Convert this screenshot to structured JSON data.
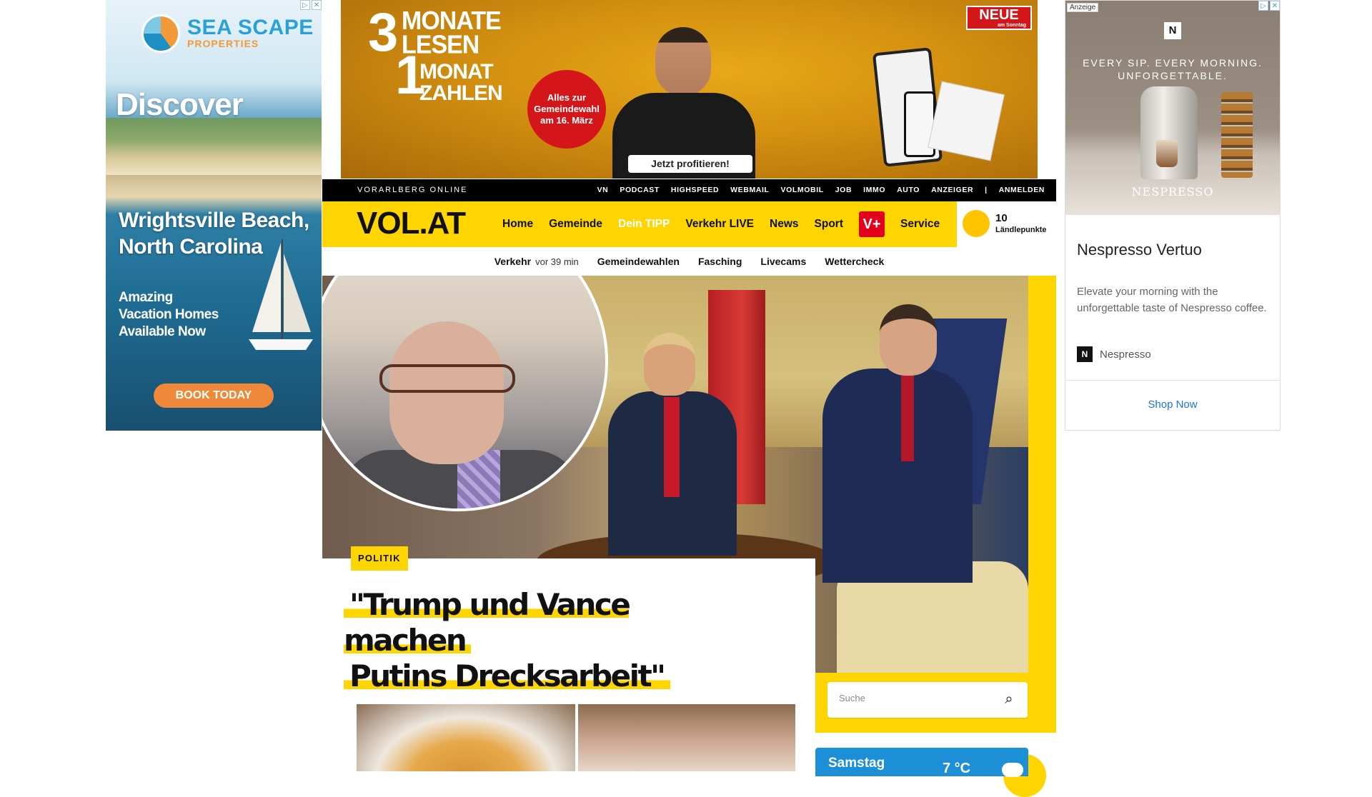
{
  "ad_left": {
    "brand_name": "SEA SCAPE",
    "brand_sub": "PROPERTIES",
    "discover": "Discover",
    "place_line1": "Wrightsville Beach,",
    "place_line2": "North Carolina",
    "tagline_line1": "Amazing",
    "tagline_line2": "Vacation Homes",
    "tagline_line3": "Available Now",
    "cta": "BOOK TODAY",
    "adchoice_i": "▷",
    "adchoice_x": "✕"
  },
  "ad_top": {
    "big3": "3",
    "line1": "MONATE LESEN",
    "big1": "1",
    "line2": "MONAT ZAHLEN",
    "circle": "Alles zur Gemeindewahl am 16. März",
    "cta": "Jetzt profitieren!",
    "brand": "NEUE",
    "brand_sub": "am Sonntag"
  },
  "ad_right": {
    "label": "Anzeige",
    "slogan_line1": "EVERY SIP. EVERY MORNING.",
    "slogan_line2": "UNFORGETTABLE.",
    "brand_mark": "N",
    "brand": "NESPRESSO",
    "title": "Nespresso Vertuo",
    "description": "Elevate your morning with the unforgettable taste of Nespresso coffee.",
    "advertiser": "Nespresso",
    "cta": "Shop Now",
    "adchoice_i": "▷",
    "adchoice_x": "✕"
  },
  "topbar": {
    "site_name": "VORARLBERG ONLINE",
    "links": [
      "VN",
      "PODCAST",
      "HIGHSPEED",
      "WEBMAIL",
      "VOLMOBIL",
      "JOB",
      "IMMO",
      "AUTO",
      "ANZEIGER",
      "|",
      "ANMELDEN"
    ]
  },
  "nav": {
    "logo": "VOL.AT",
    "items": [
      "Home",
      "Gemeinde",
      "Dein TIPP",
      "Verkehr LIVE",
      "News",
      "Sport"
    ],
    "vplus": "V+",
    "service": "Service",
    "points_value": "10",
    "points_label": "Ländlepunkte"
  },
  "subnav": {
    "traffic_label": "Verkehr",
    "traffic_ago": "vor 39 min",
    "items": [
      "Gemeindewahlen",
      "Fasching",
      "Livecams",
      "Wettercheck"
    ]
  },
  "hero": {
    "category": "POLITIK",
    "headline_line1": "\"Trump und Vance machen",
    "headline_line2": "Putins Drecksarbeit\""
  },
  "search": {
    "placeholder": "Suche",
    "icon": "⌕"
  },
  "weather": {
    "day": "Samstag",
    "temp": "7 °C"
  },
  "colors": {
    "brand_yellow": "#ffd500",
    "vplus_red": "#e3001b",
    "weather_blue": "#1c8fd6",
    "ad_top_gold": "#d38f0f"
  }
}
